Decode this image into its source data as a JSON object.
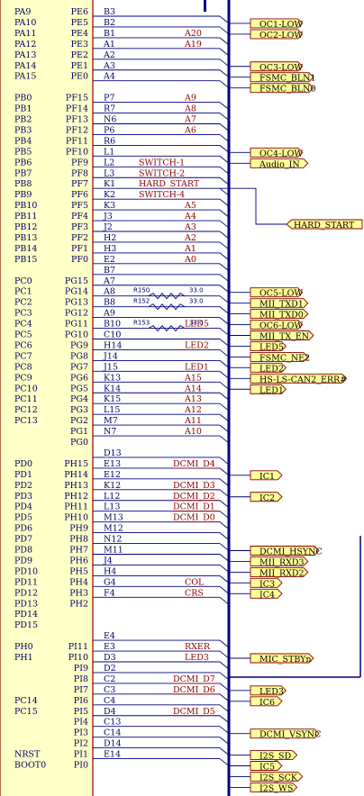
{
  "schematic": {
    "colors": {
      "chip_fill": "#ffffc8",
      "chip_border": "#8b0000",
      "pin_text": "#000060",
      "wire": "#000080",
      "net_label": "#8b0000",
      "port_fill": "#ffff99",
      "port_border": "#8b0000",
      "bus": "#000080"
    },
    "chip_pins": [
      {
        "row": 0,
        "left": "PA9",
        "right": "PE6"
      },
      {
        "row": 1,
        "left": "PA10",
        "right": "PE5"
      },
      {
        "row": 2,
        "left": "PA11",
        "right": "PE4"
      },
      {
        "row": 3,
        "left": "PA12",
        "right": "PE3"
      },
      {
        "row": 4,
        "left": "PA13",
        "right": "PE2"
      },
      {
        "row": 5,
        "left": "PA14",
        "right": "PE1"
      },
      {
        "row": 6,
        "left": "PA15",
        "right": "PE0"
      },
      {
        "row": 8,
        "left": "PB0",
        "right": "PF15"
      },
      {
        "row": 9,
        "left": "PB1",
        "right": "PF14"
      },
      {
        "row": 10,
        "left": "PB2",
        "right": "PF13"
      },
      {
        "row": 11,
        "left": "PB3",
        "right": "PF12"
      },
      {
        "row": 12,
        "left": "PB4",
        "right": "PF11"
      },
      {
        "row": 13,
        "left": "PB5",
        "right": "PF10"
      },
      {
        "row": 14,
        "left": "PB6",
        "right": "PF9"
      },
      {
        "row": 15,
        "left": "PB7",
        "right": "PF8"
      },
      {
        "row": 16,
        "left": "PB8",
        "right": "PF7"
      },
      {
        "row": 17,
        "left": "PB9",
        "right": "PF6"
      },
      {
        "row": 18,
        "left": "PB10",
        "right": "PF5"
      },
      {
        "row": 19,
        "left": "PB11",
        "right": "PF4"
      },
      {
        "row": 20,
        "left": "PB12",
        "right": "PF3"
      },
      {
        "row": 21,
        "left": "PB13",
        "right": "PF2"
      },
      {
        "row": 22,
        "left": "PB14",
        "right": "PF1"
      },
      {
        "row": 23,
        "left": "PB15",
        "right": "PF0"
      },
      {
        "row": 25,
        "left": "PC0",
        "right": "PG15"
      },
      {
        "row": 26,
        "left": "PC1",
        "right": "PG14"
      },
      {
        "row": 27,
        "left": "PC2",
        "right": "PG13"
      },
      {
        "row": 28,
        "left": "PC3",
        "right": "PG12"
      },
      {
        "row": 29,
        "left": "PC4",
        "right": "PG11"
      },
      {
        "row": 30,
        "left": "PC5",
        "right": "PG10"
      },
      {
        "row": 31,
        "left": "PC6",
        "right": "PG9"
      },
      {
        "row": 32,
        "left": "PC7",
        "right": "PG8"
      },
      {
        "row": 33,
        "left": "PC8",
        "right": "PG7"
      },
      {
        "row": 34,
        "left": "PC9",
        "right": "PG6"
      },
      {
        "row": 35,
        "left": "PC10",
        "right": "PG5"
      },
      {
        "row": 36,
        "left": "PC11",
        "right": "PG4"
      },
      {
        "row": 37,
        "left": "PC12",
        "right": "PG3"
      },
      {
        "row": 38,
        "left": "PC13",
        "right": "PG2"
      },
      {
        "row": 39,
        "left": "",
        "right": "PG1"
      },
      {
        "row": 40,
        "left": "",
        "right": "PG0"
      },
      {
        "row": 42,
        "left": "PD0",
        "right": "PH15"
      },
      {
        "row": 43,
        "left": "PD1",
        "right": "PH14"
      },
      {
        "row": 44,
        "left": "PD2",
        "right": "PH13"
      },
      {
        "row": 45,
        "left": "PD3",
        "right": "PH12"
      },
      {
        "row": 46,
        "left": "PD4",
        "right": "PH11"
      },
      {
        "row": 47,
        "left": "PD5",
        "right": "PH10"
      },
      {
        "row": 48,
        "left": "PD6",
        "right": "PH9"
      },
      {
        "row": 49,
        "left": "PD7",
        "right": "PH8"
      },
      {
        "row": 50,
        "left": "PD8",
        "right": "PH7"
      },
      {
        "row": 51,
        "left": "PD9",
        "right": "PH6"
      },
      {
        "row": 52,
        "left": "PD10",
        "right": "PH5"
      },
      {
        "row": 53,
        "left": "PD11",
        "right": "PH4"
      },
      {
        "row": 54,
        "left": "PD12",
        "right": "PH3"
      },
      {
        "row": 55,
        "left": "PD13",
        "right": "PH2"
      },
      {
        "row": 56,
        "left": "PD14",
        "right": ""
      },
      {
        "row": 57,
        "left": "PD15",
        "right": ""
      },
      {
        "row": 59,
        "left": "PH0",
        "right": "PI11"
      },
      {
        "row": 60,
        "left": "PH1",
        "right": "PI10"
      },
      {
        "row": 61,
        "left": "",
        "right": "PI9"
      },
      {
        "row": 62,
        "left": "",
        "right": "PI8"
      },
      {
        "row": 63,
        "left": "",
        "right": "PI7"
      },
      {
        "row": 64,
        "left": "PC14",
        "right": "PI6"
      },
      {
        "row": 65,
        "left": "PC15",
        "right": "PI5"
      },
      {
        "row": 66,
        "left": "",
        "right": "PI4"
      },
      {
        "row": 67,
        "left": "",
        "right": "PI3"
      },
      {
        "row": 68,
        "left": "",
        "right": "PI2"
      },
      {
        "row": 69,
        "left": "NRST",
        "right": "PI1"
      },
      {
        "row": 70,
        "left": "BOOT0",
        "right": "PI0"
      }
    ],
    "ball_labels": [
      {
        "row": 0,
        "text": "B3"
      },
      {
        "row": 1,
        "text": "B2"
      },
      {
        "row": 2,
        "text": "B1"
      },
      {
        "row": 3,
        "text": "A1"
      },
      {
        "row": 4,
        "text": "A2"
      },
      {
        "row": 5,
        "text": "A3"
      },
      {
        "row": 6,
        "text": "A4"
      },
      {
        "row": 8,
        "text": "P7"
      },
      {
        "row": 9,
        "text": "R7"
      },
      {
        "row": 10,
        "text": "N6"
      },
      {
        "row": 11,
        "text": "P6"
      },
      {
        "row": 12,
        "text": "R6"
      },
      {
        "row": 13,
        "text": "L1"
      },
      {
        "row": 14,
        "text": "L2"
      },
      {
        "row": 15,
        "text": "L3"
      },
      {
        "row": 16,
        "text": "K1"
      },
      {
        "row": 17,
        "text": "K2"
      },
      {
        "row": 18,
        "text": "K3"
      },
      {
        "row": 19,
        "text": "J3"
      },
      {
        "row": 20,
        "text": "J2"
      },
      {
        "row": 21,
        "text": "H2"
      },
      {
        "row": 22,
        "text": "H3"
      },
      {
        "row": 23,
        "text": "E2"
      },
      {
        "row": 24,
        "text": "B7"
      },
      {
        "row": 25,
        "text": "A7"
      },
      {
        "row": 26,
        "text": "A8"
      },
      {
        "row": 27,
        "text": "B8"
      },
      {
        "row": 28,
        "text": "A9"
      },
      {
        "row": 29,
        "text": "B10"
      },
      {
        "row": 30,
        "text": "C10"
      },
      {
        "row": 31,
        "text": "H14"
      },
      {
        "row": 32,
        "text": "J14"
      },
      {
        "row": 33,
        "text": "J15"
      },
      {
        "row": 34,
        "text": "K13"
      },
      {
        "row": 35,
        "text": "K14"
      },
      {
        "row": 36,
        "text": "K15"
      },
      {
        "row": 37,
        "text": "L15"
      },
      {
        "row": 38,
        "text": "M7"
      },
      {
        "row": 39,
        "text": "N7"
      },
      {
        "row": 41,
        "text": "D13"
      },
      {
        "row": 42,
        "text": "E13"
      },
      {
        "row": 43,
        "text": "E12"
      },
      {
        "row": 44,
        "text": "K12"
      },
      {
        "row": 45,
        "text": "L12"
      },
      {
        "row": 46,
        "text": "L13"
      },
      {
        "row": 47,
        "text": "M13"
      },
      {
        "row": 48,
        "text": "M12"
      },
      {
        "row": 49,
        "text": "N12"
      },
      {
        "row": 50,
        "text": "M11"
      },
      {
        "row": 51,
        "text": "J4"
      },
      {
        "row": 52,
        "text": "H4"
      },
      {
        "row": 53,
        "text": "G4"
      },
      {
        "row": 54,
        "text": "F4"
      },
      {
        "row": 58,
        "text": "E4"
      },
      {
        "row": 59,
        "text": "E3"
      },
      {
        "row": 60,
        "text": "D3"
      },
      {
        "row": 61,
        "text": "D2"
      },
      {
        "row": 62,
        "text": "C2"
      },
      {
        "row": 63,
        "text": "C3"
      },
      {
        "row": 64,
        "text": "C4"
      },
      {
        "row": 65,
        "text": "D4"
      },
      {
        "row": 66,
        "text": "C13"
      },
      {
        "row": 67,
        "text": "C14"
      },
      {
        "row": 68,
        "text": "D14"
      },
      {
        "row": 69,
        "text": "E14"
      }
    ],
    "net_labels": [
      {
        "row": 2,
        "text": "A20"
      },
      {
        "row": 3,
        "text": "A19"
      },
      {
        "row": 8,
        "text": "A9"
      },
      {
        "row": 9,
        "text": "A8"
      },
      {
        "row": 10,
        "text": "A7"
      },
      {
        "row": 11,
        "text": "A6"
      },
      {
        "row": 14,
        "text": "SWITCH-1"
      },
      {
        "row": 15,
        "text": "SWITCH-2"
      },
      {
        "row": 16,
        "text": "HARD_START"
      },
      {
        "row": 17,
        "text": "SWITCH-4"
      },
      {
        "row": 18,
        "text": "A5"
      },
      {
        "row": 19,
        "text": "A4"
      },
      {
        "row": 20,
        "text": "A3"
      },
      {
        "row": 21,
        "text": "A2"
      },
      {
        "row": 22,
        "text": "A1"
      },
      {
        "row": 23,
        "text": "A0"
      },
      {
        "row": 29,
        "text": "LED5"
      },
      {
        "row": 31,
        "text": "LED2"
      },
      {
        "row": 33,
        "text": "LED1"
      },
      {
        "row": 34,
        "text": "A15"
      },
      {
        "row": 35,
        "text": "A14"
      },
      {
        "row": 36,
        "text": "A13"
      },
      {
        "row": 37,
        "text": "A12"
      },
      {
        "row": 38,
        "text": "A11"
      },
      {
        "row": 39,
        "text": "A10"
      },
      {
        "row": 42,
        "text": "DCMI_D4"
      },
      {
        "row": 44,
        "text": "DCMI_D3"
      },
      {
        "row": 45,
        "text": "DCMI_D2"
      },
      {
        "row": 46,
        "text": "DCMI_D1"
      },
      {
        "row": 47,
        "text": "DCMI_D0"
      },
      {
        "row": 53,
        "text": "COL"
      },
      {
        "row": 54,
        "text": "CRS"
      },
      {
        "row": 59,
        "text": "RXER"
      },
      {
        "row": 60,
        "text": "LED3"
      },
      {
        "row": 62,
        "text": "DCMI_D7"
      },
      {
        "row": 63,
        "text": "DCMI_D6"
      },
      {
        "row": 65,
        "text": "DCMI_D5"
      }
    ],
    "resistors": [
      {
        "row": 26,
        "ref": "R150",
        "value": "33.0"
      },
      {
        "row": 27,
        "ref": "R152",
        "value": "33.0"
      },
      {
        "row": 29,
        "ref": "R153",
        "value": "33.0"
      }
    ],
    "ports": [
      {
        "row": 1,
        "text": "OC1-LOW"
      },
      {
        "row": 2,
        "text": "OC2-LOW"
      },
      {
        "row": 5,
        "text": "OC3-LOW"
      },
      {
        "row": 6,
        "text": "FSMC_BLN1"
      },
      {
        "row": 7,
        "text": "FSMC_BLN0"
      },
      {
        "row": 13,
        "text": "OC4-LOW"
      },
      {
        "row": 14,
        "text": "Audio_IN"
      },
      {
        "row": 26,
        "text": "OC5-LOW"
      },
      {
        "row": 27,
        "text": "MII_TXD1"
      },
      {
        "row": 28,
        "text": "MII_TXD0"
      },
      {
        "row": 29,
        "text": "OC6-LOW"
      },
      {
        "row": 30,
        "text": "MII_TX_EN"
      },
      {
        "row": 31,
        "text": "LED5"
      },
      {
        "row": 32,
        "text": "FSMC_NE2"
      },
      {
        "row": 33,
        "text": "LED2"
      },
      {
        "row": 34,
        "text": "HS-LS-CAN2_ERR#"
      },
      {
        "row": 35,
        "text": "LED1"
      },
      {
        "row": 43,
        "text": "IC1"
      },
      {
        "row": 45,
        "text": "IC2"
      },
      {
        "row": 50,
        "text": "DCMI_HSYNC"
      },
      {
        "row": 51,
        "text": "MII_RXD3"
      },
      {
        "row": 52,
        "text": "MII_RXD2"
      },
      {
        "row": 53,
        "text": "IC3"
      },
      {
        "row": 54,
        "text": "IC4"
      },
      {
        "row": 60,
        "text": "MIC_STBYn"
      },
      {
        "row": 63,
        "text": "LED3"
      },
      {
        "row": 64,
        "text": "IC6"
      },
      {
        "row": 67,
        "text": "DCMI_VSYNC"
      },
      {
        "row": 69,
        "text": "I2S_SD"
      },
      {
        "row": 70,
        "text": "IC5"
      },
      {
        "row": 71,
        "text": "I2S_SCK"
      },
      {
        "row": 72,
        "text": "I2S_WS"
      }
    ],
    "side_port": {
      "text": "HARD_START"
    }
  }
}
